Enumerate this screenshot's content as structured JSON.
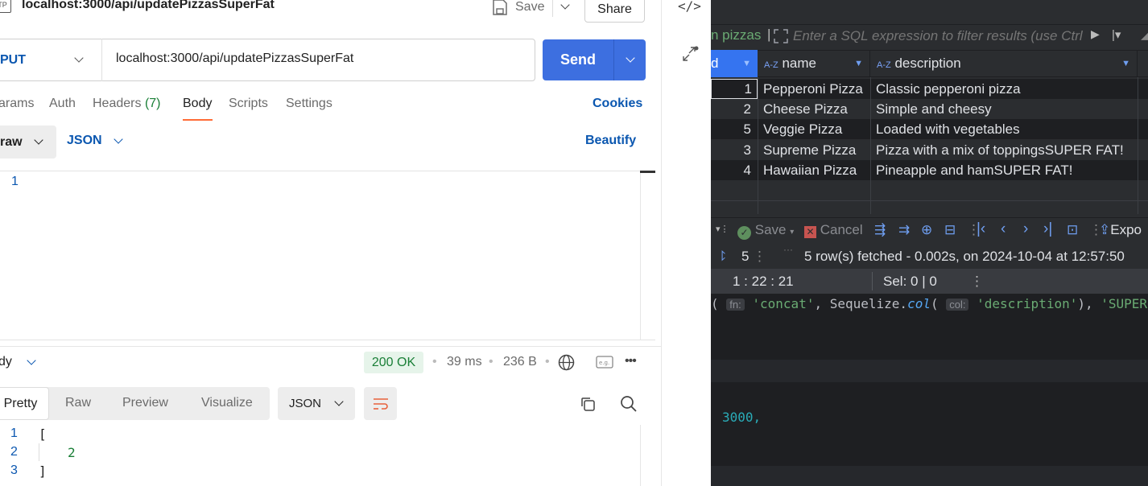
{
  "postman": {
    "request_title": "localhost:3000/api/updatePizzasSuperFat",
    "method_badge": "TP",
    "save_label": "Save",
    "share_label": "Share",
    "method": "PUT",
    "url": "localhost:3000/api/updatePizzasSuperFat",
    "send_label": "Send",
    "tabs": [
      "arams",
      "Auth",
      "Headers",
      "Body",
      "Scripts",
      "Settings"
    ],
    "headers_count": "(7)",
    "active_tab": "Body",
    "cookies_label": "Cookies",
    "body_mode": "raw",
    "body_format": "JSON",
    "beautify_label": "Beautify",
    "editor_line": "1",
    "response_section": "dy",
    "status": "200 OK",
    "time": "39 ms",
    "size": "236 B",
    "response_tabs": [
      "Pretty",
      "Raw",
      "Preview",
      "Visualize"
    ],
    "response_format": "JSON",
    "response_lines": [
      {
        "num": "1",
        "text": "["
      },
      {
        "num": "2",
        "text": "2"
      },
      {
        "num": "3",
        "text": "]"
      }
    ],
    "colors": {
      "accent": "#3d6fe0",
      "active_tab_underline": "#ff6c37",
      "status_ok": "#1a7f37"
    }
  },
  "ide": {
    "filter_prefix": "n pizzas",
    "filter_placeholder": "Enter a SQL expression to filter results (use Ctrl",
    "columns": [
      {
        "label": "d",
        "type": ""
      },
      {
        "label": "name",
        "type": "A-Z"
      },
      {
        "label": "description",
        "type": "A-Z"
      }
    ],
    "rows": [
      {
        "id": "1",
        "name": "Pepperoni Pizza",
        "description": "Classic pepperoni pizza"
      },
      {
        "id": "2",
        "name": "Cheese Pizza",
        "description": "Simple and cheesy"
      },
      {
        "id": "5",
        "name": "Veggie Pizza",
        "description": "Loaded with vegetables"
      },
      {
        "id": "3",
        "name": "Supreme Pizza",
        "description": "Pizza with a mix of toppingsSUPER FAT!"
      },
      {
        "id": "4",
        "name": "Hawaiian Pizza",
        "description": "Pineapple and hamSUPER FAT!"
      }
    ],
    "save_label": "Save",
    "cancel_label": "Cancel",
    "export_label": "Expo",
    "rows_count": "5",
    "fetch_status": "5 row(s) fetched - 0.002s, on 2024-10-04 at 12:57:50",
    "position": "1 : 22 : 21",
    "selection": "Sel: 0 | 0",
    "code_line": {
      "fn_hint": "fn:",
      "str1": "'concat'",
      "sep1": ",",
      "obj": "Sequelize.",
      "method": "col",
      "col_hint": "col:",
      "str2": "'description'",
      "sep2": "),",
      "str3": "'SUPER"
    },
    "port_line": "3000,",
    "colors": {
      "bg": "#2b2d30",
      "editor_bg": "#1e1f22",
      "string": "#6aab73",
      "number": "#2aacb8"
    }
  }
}
